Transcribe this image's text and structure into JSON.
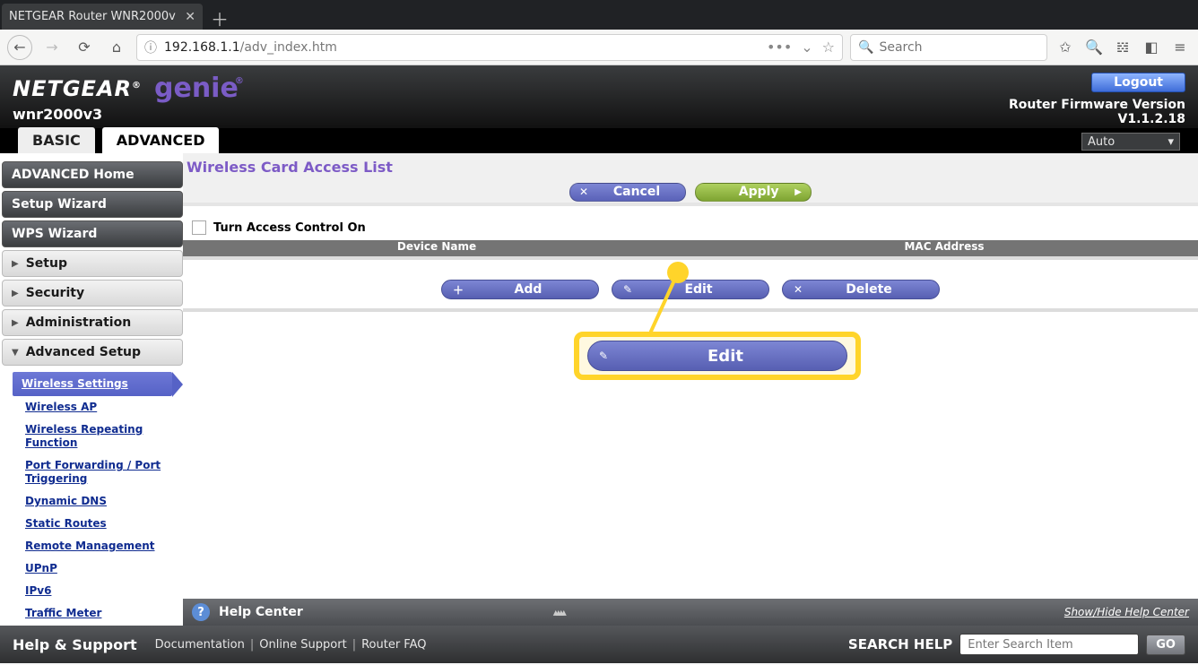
{
  "browser": {
    "tab_title": "NETGEAR Router WNR2000v",
    "url_host": "192.168.1.1",
    "url_path": "/adv_index.htm",
    "search_placeholder": "Search"
  },
  "header": {
    "brand1": "NETGEAR",
    "brand2": "genie",
    "model": "wnr2000v3",
    "logout": "Logout",
    "fw_label": "Router Firmware Version",
    "fw_version": "V1.1.2.18"
  },
  "maintabs": {
    "basic": "BASIC",
    "advanced": "ADVANCED",
    "lang": "Auto"
  },
  "sidebar": {
    "top": [
      "ADVANCED Home",
      "Setup Wizard",
      "WPS Wizard"
    ],
    "collapsed": [
      "Setup",
      "Security",
      "Administration"
    ],
    "expanded_label": "Advanced Setup",
    "sub": [
      "Wireless Settings",
      "Wireless AP",
      "Wireless Repeating Function",
      "Port Forwarding / Port Triggering",
      "Dynamic DNS",
      "Static Routes",
      "Remote Management",
      "UPnP",
      "IPv6",
      "Traffic Meter"
    ]
  },
  "content": {
    "title": "Wireless Card Access List",
    "cancel": "Cancel",
    "apply": "Apply",
    "checkbox_label": "Turn Access Control On",
    "col1": "Device Name",
    "col2": "MAC Address",
    "add": "Add",
    "edit": "Edit",
    "delete": "Delete",
    "callout_edit": "Edit"
  },
  "helpcenter": {
    "title": "Help Center",
    "toggle": "Show/Hide Help Center"
  },
  "footer": {
    "title": "Help & Support",
    "links": [
      "Documentation",
      "Online Support",
      "Router FAQ"
    ],
    "search_label": "SEARCH HELP",
    "search_placeholder": "Enter Search Item",
    "go": "GO"
  }
}
